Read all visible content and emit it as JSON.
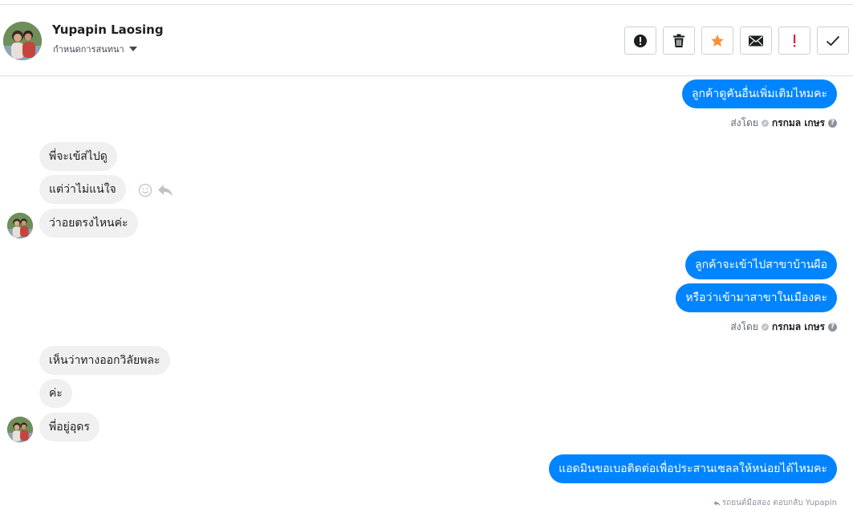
{
  "header": {
    "contact_name": "Yupapin Laosing",
    "conversation_menu_label": "กำหนดการสนทนา"
  },
  "actions": [
    {
      "name": "report-icon",
      "tooltip": ""
    },
    {
      "name": "trash-icon",
      "tooltip": ""
    },
    {
      "name": "star-icon",
      "tooltip": ""
    },
    {
      "name": "envelope-icon",
      "tooltip": ""
    },
    {
      "name": "exclamation-icon",
      "tooltip": ""
    },
    {
      "name": "check-icon",
      "tooltip": ""
    }
  ],
  "colors": {
    "outgoing_bubble": "#0084ff",
    "incoming_bubble": "#f0f0f0",
    "star": "#f7923b",
    "exclamation": "#e41e3f"
  },
  "messages": [
    {
      "dir": "out",
      "text": "ลูกค้าดูคันอื่นเพิ่มเติมไหมคะ"
    },
    {
      "dir": "in",
      "text": "พี่จะเข้ส่ไปดู"
    },
    {
      "dir": "in",
      "text": "แต่ว่าไม่แน่ใจ"
    },
    {
      "dir": "in",
      "text": "ว่าอยตรงไหนค่ะ"
    },
    {
      "dir": "out",
      "text": "ลูกค้าจะเข้าไปสาขาบ้านผือ"
    },
    {
      "dir": "out",
      "text": "หรือว่าเข้ามาสาขาในเมืองคะ"
    },
    {
      "dir": "in",
      "text": "เห็นว่าทางออกวิลัยพละ"
    },
    {
      "dir": "in",
      "text": "ค่ะ"
    },
    {
      "dir": "in",
      "text": "พี่อยู่อุดร"
    },
    {
      "dir": "out",
      "text": "แอดมินขอเบอติดต่อเพื่อประสานเซลลให้หน่อยได้ไหมคะ"
    }
  ],
  "sent_by": {
    "prefix": "ส่งโดย",
    "name": "กรกมล เกษร"
  },
  "footer": {
    "reply_note": "รถยนต์มือสอง ตอบกลับ Yupapin"
  }
}
